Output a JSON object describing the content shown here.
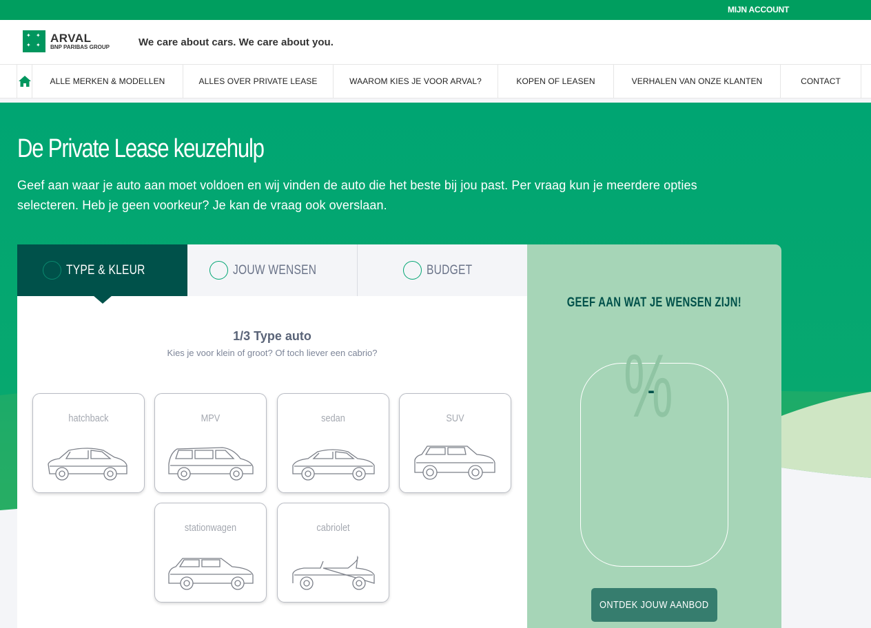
{
  "topbar": {
    "account_label": "MIJN ACCOUNT"
  },
  "header": {
    "logo_main": "ARVAL",
    "logo_sub": "BNP PARIBAS GROUP",
    "tagline": "We care about cars. We care about you."
  },
  "nav": {
    "home_icon": "home-icon",
    "items": [
      {
        "label": "ALLE MERKEN & MODELLEN"
      },
      {
        "label": "ALLES OVER PRIVATE LEASE"
      },
      {
        "label": "WAAROM KIES JE VOOR ARVAL?"
      },
      {
        "label": "KOPEN OF LEASEN"
      },
      {
        "label": "VERHALEN VAN ONZE KLANTEN"
      },
      {
        "label": "CONTACT"
      }
    ]
  },
  "hero": {
    "title": "De Private Lease keuzehulp",
    "intro": "Geef aan waar je auto aan moet voldoen en wij vinden de auto die het beste bij jou past. Per vraag kun je meerdere opties selecteren. Heb je geen voorkeur? Je kan de vraag ook overslaan."
  },
  "tabs": [
    {
      "label": "TYPE & KLEUR",
      "active": true
    },
    {
      "label": "JOUW WENSEN",
      "active": false
    },
    {
      "label": "BUDGET",
      "active": false
    }
  ],
  "question": {
    "title": "1/3 Type auto",
    "subtitle": "Kies je voor klein of groot? Of toch liever een cabrio?",
    "options": [
      {
        "label": "hatchback",
        "icon": "hatchback-car-icon"
      },
      {
        "label": "MPV",
        "icon": "mpv-car-icon"
      },
      {
        "label": "sedan",
        "icon": "sedan-car-icon"
      },
      {
        "label": "SUV",
        "icon": "suv-car-icon"
      },
      {
        "label": "stationwagen",
        "icon": "stationwagen-car-icon"
      },
      {
        "label": "cabriolet",
        "icon": "cabriolet-car-icon"
      }
    ]
  },
  "sidebar": {
    "title": "GEEF AAN WAT JE WENSEN ZIJN!",
    "match_symbol": "%",
    "match_value": "-",
    "cta_label": "ONTDEK JOUW AANBOD"
  },
  "colors": {
    "brand_green": "#00a572",
    "dark_teal": "#00514a",
    "side_panel": "#a6d5b7",
    "cta": "#367d6e"
  }
}
